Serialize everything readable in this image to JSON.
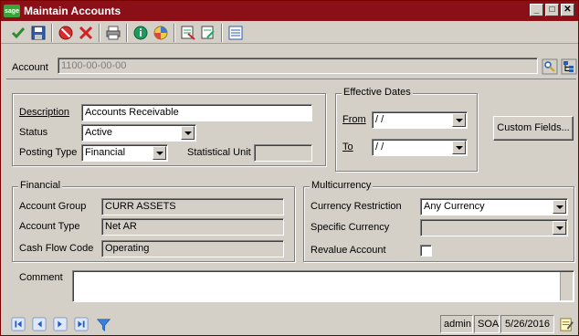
{
  "window": {
    "title": "Maintain Accounts",
    "logo_text": "sage",
    "controls": {
      "minimize": "_",
      "maximize": "□",
      "close": "✕"
    }
  },
  "toolbar": {
    "items": [
      "accept-icon",
      "save-icon",
      "cancel-icon",
      "delete-icon",
      "print-icon",
      "info-icon",
      "help-icon",
      "report-icon",
      "export-icon",
      "list-icon"
    ]
  },
  "account": {
    "label": "Account",
    "value": "1100-00-00-00"
  },
  "details": {
    "description_label": "Description",
    "description_value": "Accounts Receivable",
    "status_label": "Status",
    "status_value": "Active",
    "posting_type_label": "Posting Type",
    "posting_type_value": "Financial",
    "statistical_unit_label": "Statistical Unit",
    "statistical_unit_value": ""
  },
  "effective_dates": {
    "title": "Effective Dates",
    "from_label": "From",
    "from_value": " / /",
    "to_label": "To",
    "to_value": " / /"
  },
  "custom_fields_button": "Custom Fields...",
  "financial": {
    "title": "Financial",
    "account_group_label": "Account Group",
    "account_group_value": "CURR ASSETS",
    "account_type_label": "Account Type",
    "account_type_value": "Net AR",
    "cash_flow_code_label": "Cash Flow Code",
    "cash_flow_code_value": "Operating"
  },
  "multicurrency": {
    "title": "Multicurrency",
    "currency_restriction_label": "Currency Restriction",
    "currency_restriction_value": "Any Currency",
    "specific_currency_label": "Specific Currency",
    "specific_currency_value": "",
    "revalue_account_label": "Revalue Account",
    "revalue_account_checked": false
  },
  "comment": {
    "label": "Comment",
    "value": ""
  },
  "status": {
    "user": "admin",
    "module": "SOA",
    "date": "5/26/2016"
  },
  "colors": {
    "title_bar": "#8b0f16",
    "window_bg": "#d4d0c8",
    "nav_blue": "#1f5fbf"
  }
}
